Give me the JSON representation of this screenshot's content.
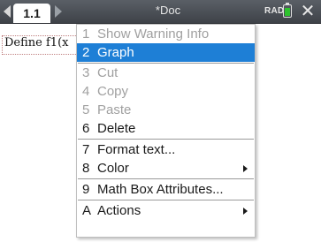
{
  "titlebar": {
    "tab_label": "1.1",
    "doc_title": "*Doc",
    "angle_mode": "RAD",
    "battery_level": 0.8,
    "close_icon": "close-icon",
    "prev_icon": "chevron-left-icon",
    "next_icon": "chevron-right-icon"
  },
  "document": {
    "entry_text": "Define f1(x"
  },
  "menu": {
    "items": [
      {
        "num": "1",
        "label": "Show Warning Info",
        "state": "disabled"
      },
      {
        "num": "2",
        "label": "Graph",
        "state": "selected"
      },
      {
        "num": "3",
        "label": "Cut",
        "state": "disabled"
      },
      {
        "num": "4",
        "label": "Copy",
        "state": "disabled"
      },
      {
        "num": "5",
        "label": "Paste",
        "state": "disabled"
      },
      {
        "num": "6",
        "label": "Delete",
        "state": "enabled"
      },
      {
        "num": "7",
        "label": "Format text...",
        "state": "enabled"
      },
      {
        "num": "8",
        "label": "Color",
        "state": "enabled",
        "submenu": true
      },
      {
        "num": "9",
        "label": "Math Box Attributes...",
        "state": "enabled"
      },
      {
        "num": "A",
        "label": "Actions",
        "state": "enabled",
        "submenu": true
      }
    ]
  },
  "colors": {
    "selection": "#1e7fd6",
    "battery": "#2ec22e",
    "titlebar": "#4a4e54"
  }
}
